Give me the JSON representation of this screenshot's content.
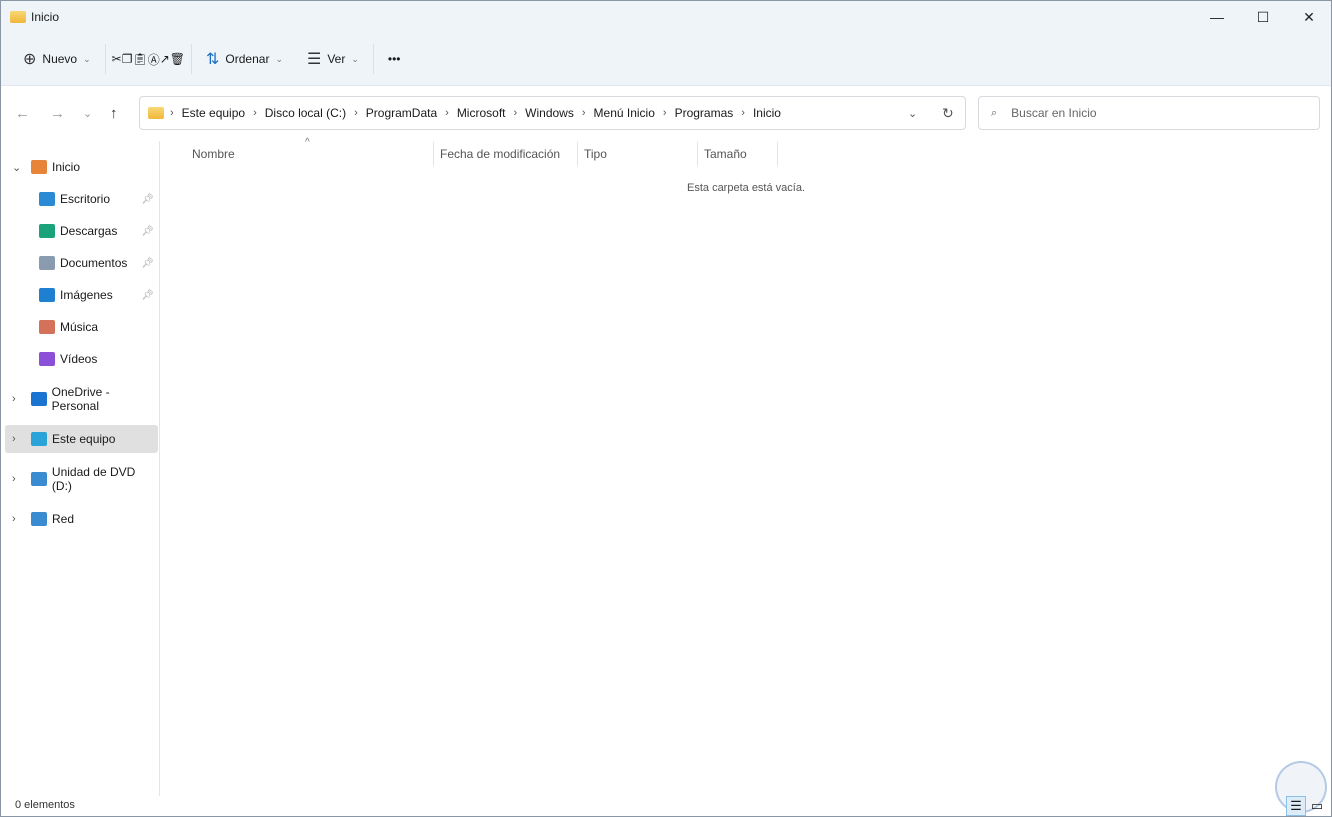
{
  "window": {
    "title": "Inicio",
    "minimize": "—",
    "maximize": "☐",
    "close": "✕"
  },
  "toolbar": {
    "new_label": "Nuevo",
    "sort_label": "Ordenar",
    "view_label": "Ver",
    "more": "•••",
    "icons": [
      "cut-icon",
      "copy-icon",
      "paste-icon",
      "rename-icon",
      "share-icon",
      "delete-icon"
    ]
  },
  "address": {
    "crumbs": [
      "Este equipo",
      "Disco local (C:)",
      "ProgramData",
      "Microsoft",
      "Windows",
      "Menú Inicio",
      "Programas",
      "Inicio"
    ]
  },
  "search": {
    "placeholder": "Buscar en Inicio"
  },
  "sidebar": {
    "items": [
      {
        "label": "Inicio",
        "icon": "home-icon",
        "color": "#e8833a"
      },
      {
        "label": "Escritorio",
        "icon": "desktop-icon",
        "color": "#2a8ad4",
        "pinned": true
      },
      {
        "label": "Descargas",
        "icon": "download-icon",
        "color": "#1aa37a",
        "pinned": true
      },
      {
        "label": "Documentos",
        "icon": "document-icon",
        "color": "#8a9bb0",
        "pinned": true
      },
      {
        "label": "Imágenes",
        "icon": "pictures-icon",
        "color": "#1f7fd1",
        "pinned": true
      },
      {
        "label": "Música",
        "icon": "music-icon",
        "color": "#d4715a"
      },
      {
        "label": "Vídeos",
        "icon": "videos-icon",
        "color": "#8b4fd8"
      },
      {
        "label": "OneDrive - Personal",
        "icon": "onedrive-icon",
        "color": "#1b74d1"
      },
      {
        "label": "Este equipo",
        "icon": "computer-icon",
        "color": "#2aa3d8",
        "selected": true
      },
      {
        "label": "Unidad de DVD (D:)",
        "icon": "dvd-icon",
        "color": "#3a8bd0"
      },
      {
        "label": "Red",
        "icon": "network-icon",
        "color": "#3a8bd0"
      }
    ]
  },
  "columns": [
    "Nombre",
    "Fecha de modificación",
    "Tipo",
    "Tamaño"
  ],
  "empty_message": "Esta carpeta está vacía.",
  "status": {
    "count": "0 elementos"
  }
}
